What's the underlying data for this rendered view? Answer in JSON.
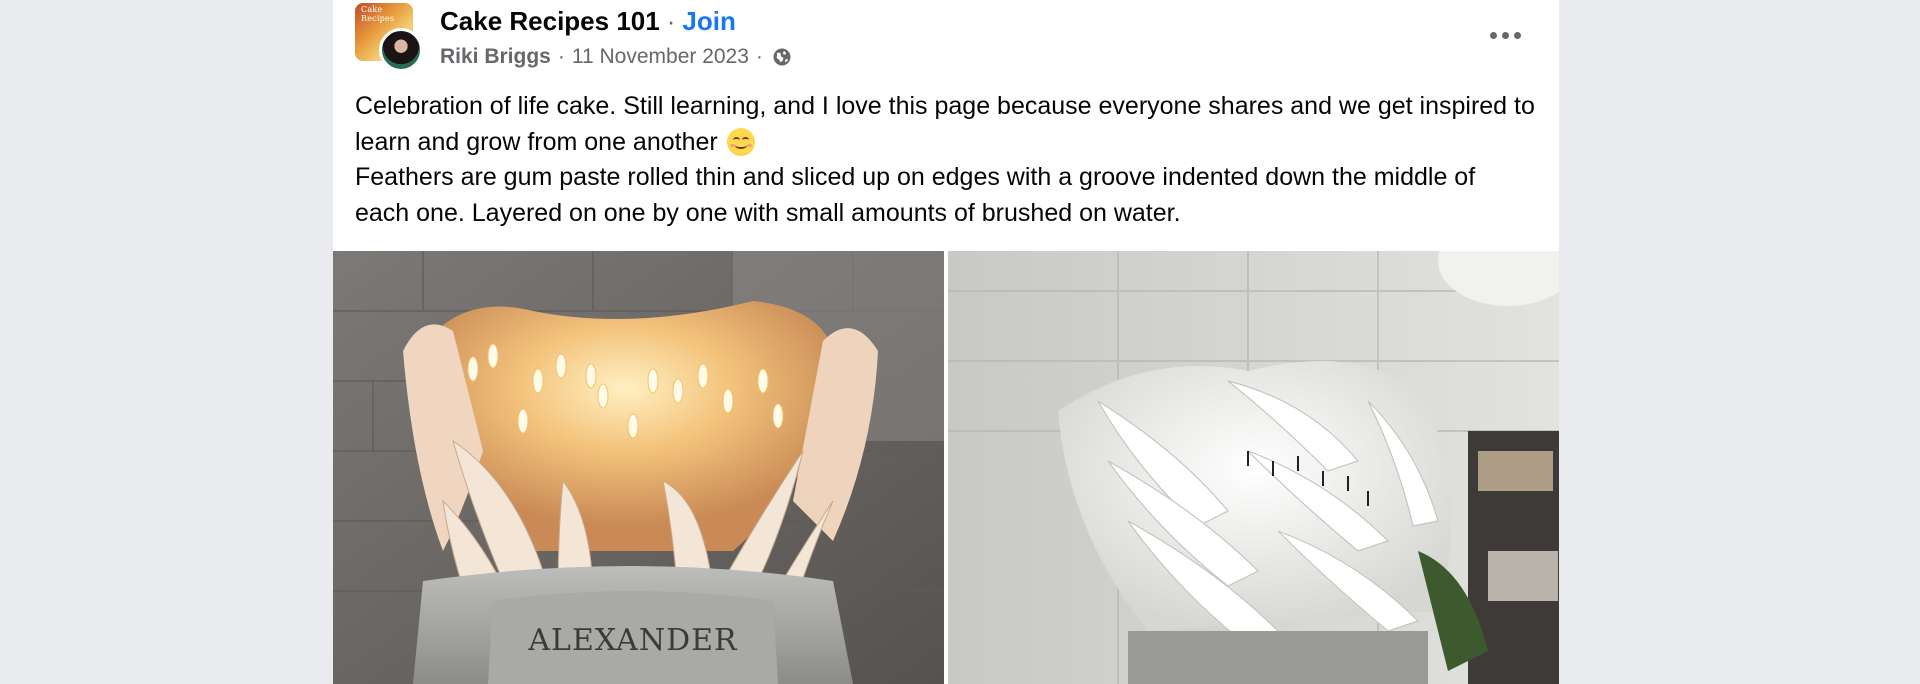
{
  "post": {
    "group_name": "Cake Recipes 101",
    "dot": "·",
    "join_label": "Join",
    "author": "Riki Briggs",
    "date": "11 November 2023",
    "meta_sep1": "·",
    "meta_sep2": "·",
    "privacy_icon": "globe-icon",
    "more_icon": "more-options-icon",
    "group_avatar_text": "Cake Recipes",
    "text_line1": "Celebration of life cake. Still learning, and I love this page because everyone shares and we get inspired to learn and grow from one another",
    "text_line2": "Feathers are gum paste rolled thin and sliced up on edges with a groove indented down the middle of each one. Layered on one by one with small amounts of brushed on water.",
    "emoji": "smiling-face-emoji"
  },
  "photos": {
    "photo1_plaque_text": "ALEXANDER"
  },
  "colors": {
    "page_bg": "#e9ebee",
    "card_bg": "#ffffff",
    "link_blue": "#1877f2",
    "secondary_text": "#65676b",
    "primary_text": "#050505"
  }
}
